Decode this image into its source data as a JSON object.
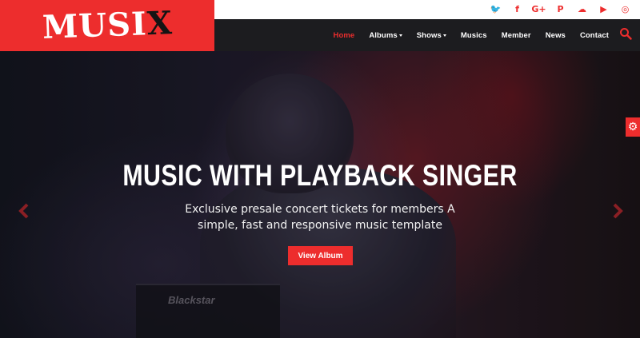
{
  "brand": {
    "logo_main": "MUSI",
    "logo_accent": "X",
    "accent_color": "#ed2d2d"
  },
  "social": [
    {
      "name": "twitter-icon",
      "glyph": "🐦"
    },
    {
      "name": "facebook-icon",
      "glyph": "f"
    },
    {
      "name": "google-plus-icon",
      "glyph": "G+"
    },
    {
      "name": "pinterest-icon",
      "glyph": "P"
    },
    {
      "name": "soundcloud-icon",
      "glyph": "☁"
    },
    {
      "name": "youtube-icon",
      "glyph": "▶"
    },
    {
      "name": "instagram-icon",
      "glyph": "◎"
    }
  ],
  "nav": {
    "items": [
      {
        "label": "Home",
        "active": true,
        "dropdown": false
      },
      {
        "label": "Albums",
        "active": false,
        "dropdown": true
      },
      {
        "label": "Shows",
        "active": false,
        "dropdown": true
      },
      {
        "label": "Musics",
        "active": false,
        "dropdown": false
      },
      {
        "label": "Member",
        "active": false,
        "dropdown": false
      },
      {
        "label": "News",
        "active": false,
        "dropdown": false
      },
      {
        "label": "Contact",
        "active": false,
        "dropdown": false
      }
    ]
  },
  "hero": {
    "title": "MUSIC WITH PLAYBACK SINGER",
    "subtitle": "Exclusive presale concert tickets for members A simple, fast and responsive music template",
    "button_label": "View Album",
    "amp_brand": "Blackstar"
  }
}
